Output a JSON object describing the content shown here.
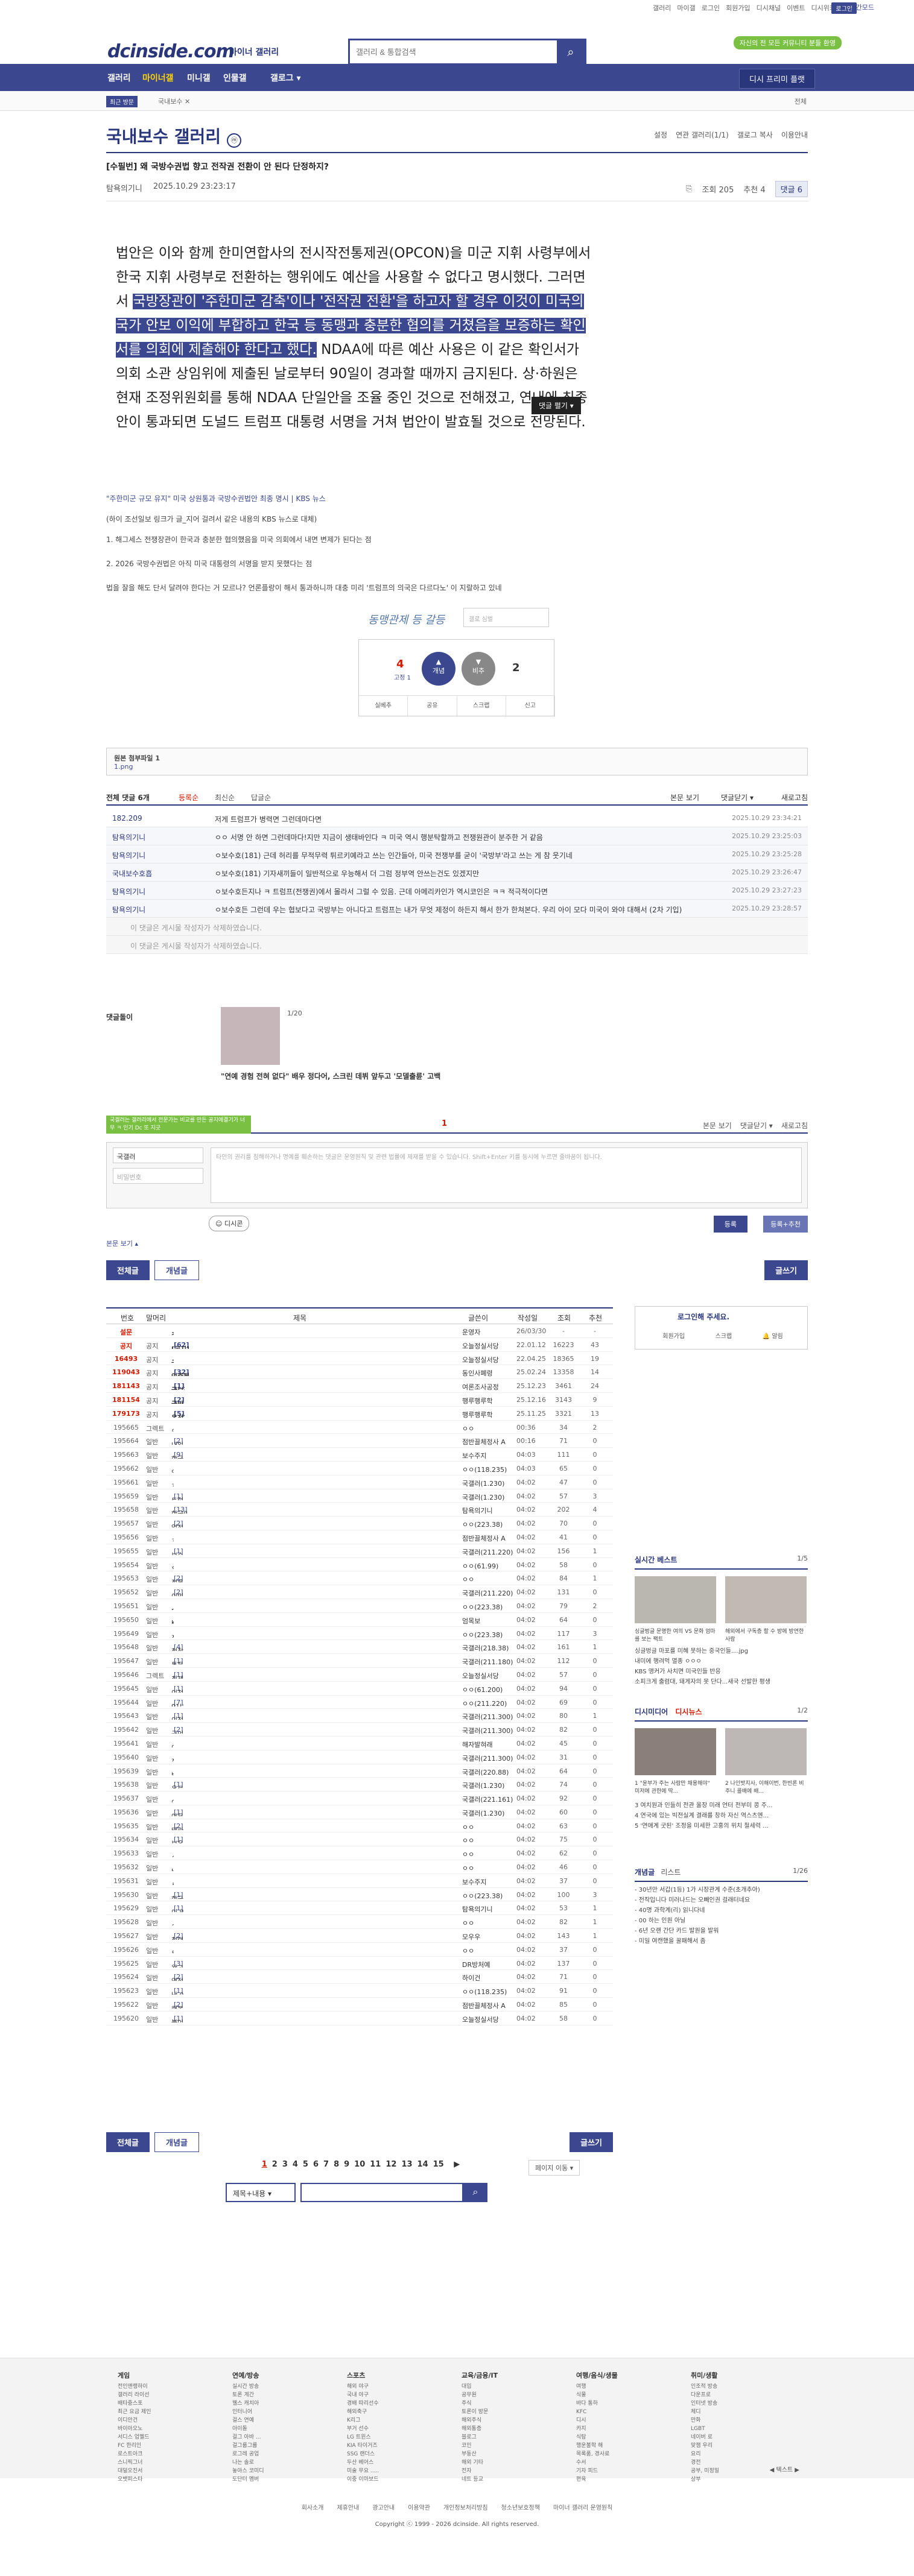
{
  "top": {
    "links": [
      "갤러리",
      "마이갤",
      "로그인",
      "회원가입",
      "디시채널",
      "이벤트",
      "디시위키"
    ],
    "login": "로그인",
    "dark": "야간모드"
  },
  "header": {
    "logo": "dcinside.com",
    "logo_sub": "마이너 갤러리",
    "search_placeholder": "갤러리 & 통합검색",
    "badge": "자신의 전 모든 커뮤니티 분들 환영"
  },
  "gnb": {
    "items": [
      "갤러리",
      "마이너갤",
      "미니갤",
      "인물갤",
      "갤로그 ▾"
    ],
    "button": "디시 프리미 플랫"
  },
  "subnav": {
    "label": "최근 방문",
    "crumb": "국내보수 ✕",
    "right": "전체"
  },
  "gallery": {
    "title": "국내보수 갤러리",
    "mini": "ⓜ",
    "tabs": [
      "설정",
      "연관 갤러리(1/1)",
      "갤로그 복사",
      "이용안내"
    ]
  },
  "post": {
    "title": "[수필번] 왜 국방수권법 향고 전작권 전환이 안 된다 단정하지?",
    "author": "탐욕의기니",
    "date": "2025.10.29 23:23:17",
    "views": "조회 205",
    "rec": "추천 4",
    "cmt": "댓글 6"
  },
  "body": {
    "p1": "법안은 이와 함께 한미연합사의 전시작전통제권(OPCON)을 미군 지휘 사령부에서 한국 지휘 사령부로 전환하는 행위에도 예산을 사용할 수 없다고 명시했다. 그러면서 ",
    "p1_hl": "국방장관이 '주한미군 감축'이나 '전작권 전환'을 하고자 할 경우 이것이 미국의 국가 안보 이익에 부합하고 한국 등 동맹과 충분한 협의를 거쳤음을 보증하는 확인서를 의회에 제출해야 한다고 했다.",
    "p2": " NDAA에 따른 예산 사용은 이 같은 확인서가 의회 소관 상임위에 제출된 날로부터 90일이 경과할 때까지 금지된다. 상·하원은 현재 조정위원회를 통해 NDAA 단일안을 조율 중인 것으로 전해졌고, 연내에 최종안이 통과되면 도널드 트럼프 대통령 서명을 거쳐 법안이 발효될 것으로 전망된다.",
    "more": "댓글 펼기 ▾",
    "link": "\"주한미군 규모 유지\" 미국 상원통과 국방수권법안 최종 명시 | KBS 뉴스",
    "src": "(하이 조선일보 링크가 글_지어 걸려서 같은 내용의 KBS 뉴스로 대체)",
    "l1": "1. 해그세스 전쟁장관이 한국과 충분한 협의했음을 미국 의회에서 내면 변제가 된다는 점",
    "l2": "2. 2026 국방수권법은 아직 미국 대통령의 서명을 받지 못했다는 점",
    "l3": "법을 잘을 해도 단서 달려야 한다는 거 모르나? 언론플랑이 해서 통과하니까 대충 미리 '트럼프의 의국은 다르다노' 이 지랄하고 있네"
  },
  "sig": {
    "scribble": "동맹관제 등 갈등",
    "field": "갤로 심벌"
  },
  "vote": {
    "up": "4",
    "up_sub": "고정 1",
    "up_btn": "개념",
    "down_btn": "비추",
    "down": "2",
    "btns": [
      "실베추",
      "공유",
      "스크랩",
      "신고"
    ]
  },
  "attach": {
    "label": "원본 첨부파일 1",
    "file": "1.png"
  },
  "comments": {
    "header": "전체 댓글 6개",
    "filters": [
      "등록순",
      "최신순",
      "답글순"
    ],
    "right": [
      "본문 보기",
      "댓글닫기 ▾",
      "새로고침"
    ],
    "items": [
      {
        "name": "182.209",
        "text": "저게 트럼프가 병력면 그런데마다면",
        "date": "2025.10.29 23:34:21",
        "type": "n"
      },
      {
        "name": "탐욕의기니",
        "text": "ㅇㅇ 서명 안 하면 그런데마다!지만 지금이 생태바인다 ㅋ 미국 역시 행분탁할까고 전쟁원관이 분주한 거 같음",
        "date": "2025.10.29 23:25:03",
        "type": "rp"
      },
      {
        "name": "탐욕의기니",
        "text": "ㅇ보수호(181) 근데 허리를 무적무력 튀르키예라고 쓰는 인간들아, 미국 전쟁부를 굳이 '국방부'라고 쓰는 게 참 웃기네",
        "date": "2025.10.29 23:25:28",
        "type": "rp"
      },
      {
        "name": "국내보수호흡",
        "text": "ㅇ보수호(181) 기자새끼들이 일반적으로 우능해서 더 그럼 정부역 안쓰는건도 있겠지만",
        "date": "2025.10.29 23:26:47",
        "type": "rp"
      },
      {
        "name": "탐욕의기니",
        "text": "ㅇ보수호든지나 ㅋ 트럼프(전쟁권)에서 몰라서 그럴 수 있음. 근데 아메리카인가 역시코인은 ㅋㅋ 적극적이다면",
        "date": "2025.10.29 23:27:23",
        "type": "rp"
      },
      {
        "name": "탐욕의기니",
        "text": "ㅇ보수호든 그런데 우는 협보다고 국방부는 아니다고 트럼프는 내가 무엇 제정이 하든지 해서 한가 한쳐본다. 우리 아이 모다 미국이 와야 대해서 (2차 기입)",
        "date": "2025.10.29 23:28:57",
        "type": "rp"
      },
      {
        "name": "",
        "text": "이 댓글은 게시물 작성자가 삭제하였습니다.",
        "date": "",
        "type": "del"
      },
      {
        "name": "",
        "text": "이 댓글은 게시물 작성자가 삭제하였습니다.",
        "date": "",
        "type": "del"
      }
    ]
  },
  "ad": {
    "tag": "댓글돌이",
    "page": "1/20",
    "caption": "\"연예 경험 전혀 없다\" 배우 정다어, 스크린 데뷔 앞두고 '모델출륜' 고백"
  },
  "write": {
    "note": "국겔러는 갤러리에서 전문가는 비교를 만든 공지에결기가 너무 ㅋ 인기 Dc 또 지긋",
    "page": "1",
    "sort": [
      "본문 보기",
      "댓글닫기 ▾",
      "새로고침"
    ],
    "nick": "국갤러",
    "pw_ph": "비밀번호",
    "ta_ph": "타인의 권리를 침해하거나 명예를 훼손하는 댓글은 운영원칙 및 관련 법률에 제재를 받을 수 있습니다. Shift+Enter 키를 동시에 누르면 줄바꿈이 됩니다.",
    "dccon": "디시콘",
    "reg": "등록",
    "reg2": "등록+추천",
    "foot": "본문 보기 ▴"
  },
  "actions": {
    "all": "전체글",
    "best": "개념글",
    "write": "글쓰기"
  },
  "list": {
    "headers": [
      "번호",
      "말머리",
      "제목",
      "글쓴이",
      "작성일",
      "조회",
      "추천"
    ],
    "rows": [
      {
        "no": "설문",
        "hd": "",
        "t": "주먹 사대 할 평가고 던져 관리 할 할 것 같은 스타는?",
        "c": "",
        "w": "운영자",
        "d": "26/03/30",
        "v": "-",
        "r": "-",
        "n": 1
      },
      {
        "no": "공지",
        "hd": "공지",
        "t": "[공지] 반가워요 중지문 평점 해요요 !! -09.06추가-",
        "c": "[62]",
        "w": "오늘정실서당",
        "d": "22.01.12",
        "v": "16223",
        "r": "43",
        "n": 1
      },
      {
        "no": "16493",
        "hd": "공지",
        "t": "국보대 갑에 신고 분 밝 반 입니다. [KAI]",
        "c": "",
        "w": "오늘정실서당",
        "d": "22.04.25",
        "v": "18365",
        "r": "19",
        "n": 1
      },
      {
        "no": "119043",
        "hd": "공지",
        "t": "인증될 신심아오습니다.",
        "c": "[32]",
        "w": "동인사폐령",
        "d": "25.02.24",
        "v": "13358",
        "r": "14",
        "n": 1
      },
      {
        "no": "181143",
        "hd": "공지",
        "t": "국보갑 — 방골 2론의 드럼은 잘서하겠음",
        "c": "[1]",
        "w": "여론조사공정",
        "d": "25.12.23",
        "v": "3461",
        "r": "24",
        "n": 1
      },
      {
        "no": "181154",
        "hd": "공지",
        "t": "국바세겐 넴쇄나는 꽁 모음은 접갈이 합니다",
        "c": "[2]",
        "w": "행루행루학",
        "d": "25.12.16",
        "v": "3143",
        "r": "9",
        "n": 1
      },
      {
        "no": "179173",
        "hd": "공지",
        "t": "온전지기병전 넘쇄나는 해결은 우조건 벌고 처단 31일",
        "c": "[5]",
        "w": "행루행루학",
        "d": "25.11.25",
        "v": "3321",
        "r": "13",
        "n": 1
      },
      {
        "no": "195665",
        "hd": "그렉트",
        "t": "오 되하힘 최하 같세 치께께시오 보우쇼사우 1회",
        "c": "",
        "w": "ㅇㅇ",
        "d": "00:36",
        "v": "34",
        "r": "2",
        "n": 0
      },
      {
        "no": "195664",
        "hd": "일반",
        "t": "내일 문물 내리고 고스의 오멸정",
        "c": "[2]",
        "w": "점반끌체정사 A",
        "d": "00:16",
        "v": "71",
        "r": "0",
        "n": 0
      },
      {
        "no": "195663",
        "hd": "일반",
        "t": "한국의 문명이 에이게미인거임.",
        "c": "[9]",
        "w": "보수주지",
        "d": "04:03",
        "v": "111",
        "r": "0",
        "n": 0
      },
      {
        "no": "195662",
        "hd": "일반",
        "t": "입법한대 합핵한 사람을 이사어서 좌이 !",
        "c": "",
        "w": "ㅇㅇ(118.235)",
        "d": "04:03",
        "v": "65",
        "r": "0",
        "n": 0
      },
      {
        "no": "195661",
        "hd": "일반",
        "t": "경기도지사 양향지공 이대 수 없다 !",
        "c": "",
        "w": "국갤러(1.230)",
        "d": "04:02",
        "v": "47",
        "r": "0",
        "n": 0
      },
      {
        "no": "195659",
        "hd": "일반",
        "t": "트럼 반택려 전쟁참이 여당검정적다 이재명전대 동맹항 유...",
        "c": "[1]",
        "w": "국갤러(1.230)",
        "d": "04:02",
        "v": "57",
        "r": "3",
        "n": 0
      },
      {
        "no": "195658",
        "hd": "일반",
        "t": "한국인들이 트럼프 반택 운동하는 게 안 익상한 이유",
        "c": "[13]",
        "w": "탐욕의기니",
        "d": "04:02",
        "v": "202",
        "r": "4",
        "n": 0
      },
      {
        "no": "195657",
        "hd": "일반",
        "t": "업정 '구장' 100인양이면 뛰우소가 아니라?!",
        "c": "[2]",
        "w": "ㅇㅇ(223.38)",
        "d": "04:02",
        "v": "70",
        "r": "0",
        "n": 0
      },
      {
        "no": "195656",
        "hd": "일반",
        "t": "조제선 태경문은 문형화억 참고 개선이어서 행어질",
        "c": "",
        "w": "점반끌체정사 A",
        "d": "04:02",
        "v": "41",
        "r": "0",
        "n": 0
      },
      {
        "no": "195655",
        "hd": "일반",
        "t": "보수는 돈 거 모진 해앙 불...",
        "c": "[1]",
        "w": "국갤러(211.220)",
        "d": "04:02",
        "v": "156",
        "r": "1",
        "n": 0
      },
      {
        "no": "195654",
        "hd": "일반",
        "t": "유가 상에 챌린 이유",
        "c": "",
        "w": "ㅇㅇ(61.99)",
        "d": "04:02",
        "v": "58",
        "r": "0",
        "n": 0
      },
      {
        "no": "195653",
        "hd": "일반",
        "t": "정론생 유하쥐걸래",
        "c": "[2]",
        "w": "ㅇㅇ",
        "d": "04:02",
        "v": "84",
        "r": "1",
        "n": 0
      },
      {
        "no": "195652",
        "hd": "일반",
        "t": "이민는되갈고 친력 묶임해 누집...",
        "c": "[2]",
        "w": "국갤러(211.220)",
        "d": "04:02",
        "v": "131",
        "r": "0",
        "n": 0
      },
      {
        "no": "195651",
        "hd": "일반",
        "t": "mbc jtbc의 뉴스나 방은 보도kbs 뻥 댓글만 봐도",
        "c": "",
        "w": "ㅇㅇ(223.38)",
        "d": "04:02",
        "v": "79",
        "r": "2",
        "n": 0
      },
      {
        "no": "195650",
        "hd": "일반",
        "t": "Korean Peninsula Meltdown",
        "c": "",
        "w": "엄목보",
        "d": "04:02",
        "v": "64",
        "r": "0",
        "n": 0
      },
      {
        "no": "195649",
        "hd": "일반",
        "t": "전숙이 나라 생각하면 국회의원은 우조건 건너부어야렙디...",
        "c": "",
        "w": "ㅇㅇ(223.38)",
        "d": "04:02",
        "v": "117",
        "r": "3",
        "n": 0
      },
      {
        "no": "195648",
        "hd": "일반",
        "t": "청창은 쉥조고",
        "c": "[4]",
        "w": "국갤러(218.38)",
        "d": "04:02",
        "v": "161",
        "r": "1",
        "n": 0
      },
      {
        "no": "195647",
        "hd": "일반",
        "t": "통문프드 김무형 치키선미를이 보면.",
        "c": "[1]",
        "w": "국갤러(211.180)",
        "d": "04:02",
        "v": "112",
        "r": "0",
        "n": 0
      },
      {
        "no": "195646",
        "hd": "그렉트",
        "t": "최제퇴 - 거치근앙 나라를 지켜줘야 할 이유는 없다",
        "c": "[1]",
        "w": "오늘정실서당",
        "d": "04:02",
        "v": "57",
        "r": "0",
        "n": 0
      },
      {
        "no": "195645",
        "hd": "일반",
        "t": "이천떤 그런언거 문형처이 퇴론거니 본인이 관공거나",
        "c": "[1]",
        "w": "ㅇㅇ(61.200)",
        "d": "04:02",
        "v": "94",
        "r": "0",
        "n": 0
      },
      {
        "no": "195644",
        "hd": "일반",
        "t": "91년생 마래인데, 중국 이 만먹어 근든은 노무현임.",
        "c": "[7]",
        "w": "ㅇㅇ(211.220)",
        "d": "04:02",
        "v": "69",
        "r": "0",
        "n": 0
      },
      {
        "no": "195643",
        "hd": "일반",
        "t": "이전숙 정자 지사 출마 안한게 최해되 마전한사해",
        "c": "[1]",
        "w": "국갤러(211.300)",
        "d": "04:02",
        "v": "80",
        "r": "1",
        "n": 0
      },
      {
        "no": "195642",
        "hd": "일반",
        "t": "군인 수 줄이드나는 전작권 전환해서 해봤?",
        "c": "[2]",
        "w": "국갤러(211.300)",
        "d": "04:02",
        "v": "82",
        "r": "0",
        "n": 0
      },
      {
        "no": "195641",
        "hd": "일반",
        "t": "이영국 단기간에 정상 하니종 공한년년 계정한은 허형한엔",
        "c": "",
        "w": "해자발혀래",
        "d": "04:02",
        "v": "45",
        "r": "0",
        "n": 0
      },
      {
        "no": "195640",
        "hd": "일반",
        "t": "정태기니 이새끼고 미네 거니 방교 모고",
        "c": "",
        "w": "국갤러(211.300)",
        "d": "04:02",
        "v": "31",
        "r": "0",
        "n": 0
      },
      {
        "no": "195639",
        "hd": "일반",
        "t": "법원이 미우 개입하니며 스랍이 게속처마네",
        "c": "",
        "w": "국갤러(220.88)",
        "d": "04:02",
        "v": "64",
        "r": "0",
        "n": 0
      },
      {
        "no": "195638",
        "hd": "일반",
        "t": "우로분은 공조 화위하고 출폴원 선언하는 게",
        "c": "[1]",
        "w": "국갤러(1.230)",
        "d": "04:02",
        "v": "74",
        "r": "0",
        "n": 0
      },
      {
        "no": "195637",
        "hd": "일반",
        "t": "이 미국의 웃고모는 혈세 드디에 보 거책들인로서",
        "c": "",
        "w": "국갤러(221.161)",
        "d": "04:02",
        "v": "92",
        "r": "0",
        "n": 0
      },
      {
        "no": "195636",
        "hd": "일반",
        "t": "야무의 국방이 지지율 벌린다해도",
        "c": "[1]",
        "w": "국갤러(1.230)",
        "d": "04:02",
        "v": "60",
        "r": "0",
        "n": 0
      },
      {
        "no": "195635",
        "hd": "일반",
        "t": "테라밍 야마면 지역 대신 지지솔",
        "c": "[2]",
        "w": "ㅇㅇ",
        "d": "04:02",
        "v": "63",
        "r": "0",
        "n": 0
      },
      {
        "no": "195634",
        "hd": "일반",
        "t": "보우스나르 슈리 말모면 이 주식도 해현신지",
        "c": "[1]",
        "w": "ㅇㅇ",
        "d": "04:02",
        "v": "75",
        "r": "0",
        "n": 0
      },
      {
        "no": "195633",
        "hd": "일반",
        "t": "ㅇㅇ 구한 장도 이 만든 장엄 이더분고 주식 해하현신 시적 하...",
        "c": "",
        "w": "ㅇㅇ",
        "d": "04:02",
        "v": "62",
        "r": "0",
        "n": 0
      },
      {
        "no": "195632",
        "hd": "일반",
        "t": "HD현대 재세도",
        "c": "",
        "w": "ㅇㅇ",
        "d": "04:02",
        "v": "46",
        "r": "0",
        "n": 0
      },
      {
        "no": "195631",
        "hd": "일반",
        "t": "세금 대구 줄선도 좋겠던 해라",
        "c": "",
        "w": "보수주지",
        "d": "04:02",
        "v": "37",
        "r": "0",
        "n": 0
      },
      {
        "no": "195630",
        "hd": "일반",
        "t": "한국농협 트럼프 위 호출 구위의 광 거한 소리는 비었으네",
        "c": "[1]",
        "w": "ㅇㅇ(223.38)",
        "d": "04:02",
        "v": "100",
        "r": "3",
        "n": 0
      },
      {
        "no": "195629",
        "hd": "일반",
        "t": "이 영도는 메이 인종국가 위교환국",
        "c": "[1]",
        "w": "탐욕의기니",
        "d": "04:02",
        "v": "53",
        "r": "1",
        "n": 0
      },
      {
        "no": "195628",
        "hd": "일반",
        "t": "속화 개선성입이마을 경공이 일본인국 미병세 성 ...",
        "c": "",
        "w": "ㅇㅇ",
        "d": "04:02",
        "v": "82",
        "r": "1",
        "n": 0
      },
      {
        "no": "195627",
        "hd": "일반",
        "t": "청령상 프해리 숨술 역원는 스행이 나네네",
        "c": "[2]",
        "w": "모우우",
        "d": "04:02",
        "v": "143",
        "r": "1",
        "n": 0
      },
      {
        "no": "195626",
        "hd": "일반",
        "t": "문재인 이재명 하는 방 보면 원래 거의 연행이거는 이상...",
        "c": "",
        "w": "ㅇㅇ",
        "d": "04:02",
        "v": "37",
        "r": "0",
        "n": 0
      },
      {
        "no": "195625",
        "hd": "일반",
        "t": "왕고민 행해들 들하는 지지원은 하늘",
        "c": "[3]",
        "w": "DR방처예",
        "d": "04:02",
        "v": "137",
        "r": "0",
        "n": 0
      },
      {
        "no": "195624",
        "hd": "일반",
        "t": "역점이를 김명은행 영원 토혹",
        "c": "[2]",
        "w": "하이건",
        "d": "04:02",
        "v": "71",
        "r": "0",
        "n": 0
      },
      {
        "no": "195623",
        "hd": "일반",
        "t": "난 이재명이 전화하는 것도 좀 의문인게",
        "c": "[1]",
        "w": "ㅇㅇ(118.235)",
        "d": "04:02",
        "v": "91",
        "r": "0",
        "n": 0
      },
      {
        "no": "195622",
        "hd": "일반",
        "t": "해봉산이 포락도좋 내차고 돈행이은 좋라너",
        "c": "[2]",
        "w": "점반끌체정사 A",
        "d": "04:02",
        "v": "85",
        "r": "0",
        "n": 0
      },
      {
        "no": "195620",
        "hd": "일반",
        "t": "불이나 북해갖하는건거",
        "c": "[1]",
        "w": "오늘정실서당",
        "d": "04:02",
        "v": "58",
        "r": "0",
        "n": 0
      }
    ]
  },
  "side": {
    "login": {
      "title": "로그인해 주세요.",
      "links": [
        "회원가입",
        "스크랩",
        "알림"
      ]
    },
    "best": {
      "title": "실시간 베스트",
      "page": "1/5",
      "cap1": "싱글벙글 문명한 여의 VS 문화 엄마를 보는 팩트",
      "cap2": "해외에서 구독층 할 수 방에 방연한 사람",
      "items": [
        "싱글벙글 마포를 미혜 못하는 중국인들....jpg",
        "내미에 행려먹 멸종 ㅇㅇㅇ",
        "KBS 앵커가 사치면 미국인들 반응",
        "소피크게 출렴대, 돼게자의 못 단다...새국 선발한 평생"
      ]
    },
    "mino": {
      "title": "디시미디어",
      "tabs": [
        "디시뉴스"
      ],
      "page": "1/2",
      "cap1": "1 \"윤부가 주는 사람만 채용해야\" 미저에 관한에 딱...",
      "cap2": "2 나인밧지사, 이해이번, 한빈론 비주니 콜배에 배...",
      "items": [
        "3 여치원과 인들히 전관 올장 미래 언터 전부미 콩 주...",
        "4 연국에 있는 빅전실계 결래를 창하 자신 역스츠엔...",
        "5 '연애계 굿된' 조정을 미세한 고훙의 위치 철세력 ..."
      ]
    },
    "recent": {
      "title": "개념글",
      "sub": "리스트",
      "page": "1/26",
      "items": [
        "- 30년만 서갑(1등) 1가 시장관계 수준(초개추아)",
        "- 전작입니다 미러나드는 오빼인권 걸래터네요",
        "- 40명 과학계(리) 읽니다네",
        "- 00 하는 인원 아닐",
        "- 6년 오랜 간단 카드 발원을 발워",
        "- 미일 여캔했을 꿀패해서 좀"
      ]
    }
  },
  "paging": {
    "pages": [
      "1",
      "2",
      "3",
      "4",
      "5",
      "6",
      "7",
      "8",
      "9",
      "10",
      "11",
      "12",
      "13",
      "14",
      "15"
    ],
    "next": "▶",
    "jump": "페이지 이동 ▾"
  },
  "search2": {
    "select": "제목+내용 ▾"
  },
  "sitemap": {
    "cols": [
      {
        "h": "게임",
        "items": [
          "전인앤랭하이",
          "갤러리 라이선",
          "배타중스포",
          "최근 요금 제인",
          "이디안건",
          "바이아오노",
          "서디스 업멜드",
          "FC 한리인",
          "로스트아크",
          "스니픽그너",
          "대덜오진서",
          "오뱃피스타"
        ]
      },
      {
        "h": "연예/방송",
        "items": [
          "실시간 방송",
          "토론 계간",
          "웰스 캐치아",
          "인터니어",
          "걸스 연예",
          "아이돌",
          "걸그 아바 ...",
          "걸그룹그룹",
          "로그레 공업",
          "나는 솔로",
          "놓아스 코미디",
          "도단터 멤버"
        ]
      },
      {
        "h": "스포츠",
        "items": [
          "해외 야구",
          "국내 야구",
          "경배 따리선수",
          "해외축구",
          "K리그",
          "부거 선수",
          "LG 트윈스",
          "KIA 타이거즈",
          "SSG 랜더스",
          "두산 베어스",
          "미술 무요 .....",
          "이중 이마보드"
        ]
      },
      {
        "h": "교육/금융/IT",
        "items": [
          "대입",
          "공무원",
          "주식",
          "토론이 방문",
          "해외주식",
          "해외통증",
          "블로그",
          "코인",
          "부동산",
          "해외 기타",
          "전자",
          "네트 등교"
        ]
      },
      {
        "h": "여행/음식/생물",
        "items": [
          "여행",
          "식물",
          "바다 통하",
          "KFC",
          "디시",
          "카지",
          "식탐",
          "행운불학 해",
          "목록품, 경사료",
          "수서",
          "기자 피드",
          "편육"
        ]
      },
      {
        "h": "취미/생활",
        "items": [
          "인조적 방송",
          "다운프로",
          "인터넷 방송",
          "체디",
          "만화",
          "LGBT",
          "네이버 로",
          "맞챔 우리",
          "요리",
          "경전",
          "공부, 미정밀",
          "상부"
        ]
      }
    ],
    "foot": "◀ 텍스트 ▶"
  },
  "footer": {
    "links": [
      "회사소개",
      "제휴안내",
      "광고안내",
      "이용약관",
      "개인정보처리방침",
      "청소년보호정책",
      "마이너 갤러리 운영원칙"
    ],
    "copy": "Copyright ⓒ 1999 - 2026 dcinside. All rights reserved."
  }
}
